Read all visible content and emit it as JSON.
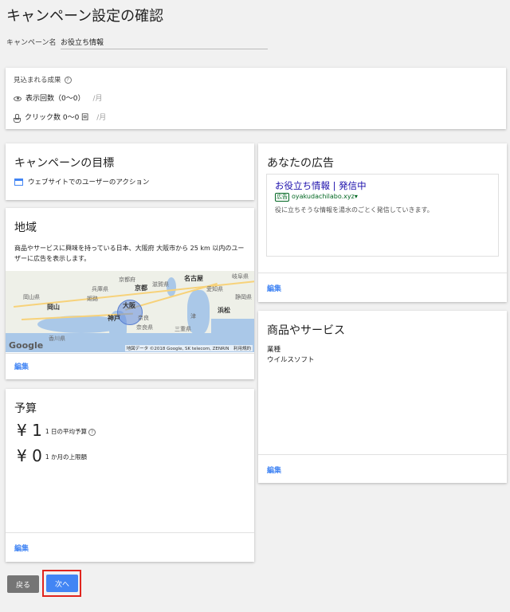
{
  "page": {
    "title": "キャンペーン設定の確認"
  },
  "campaign_name": {
    "label": "キャンペーン名",
    "value": "お役立ち情報"
  },
  "estimate": {
    "title": "見込まれる成果",
    "help_icon": "?",
    "impressions": {
      "label": "表示回数（0〜0）",
      "unit": "/月"
    },
    "clicks": {
      "label": "クリック数 0〜0 回",
      "unit": "/月"
    }
  },
  "goal": {
    "title": "キャンペーンの目標",
    "value": "ウェブサイトでのユーザーのアクション"
  },
  "region": {
    "title": "地域",
    "description": "商品やサービスに興味を持っている日本、大阪府 大阪市から 25 km 以内のユーザーに広告を表示します。",
    "edit": "編集",
    "map": {
      "logo": "Google",
      "attribution": "地図データ ©2018 Google, SK telecom, ZENRIN　利用規約",
      "labels": {
        "kyoto_city": "京都",
        "kyoto_pref": "京都府",
        "nagoya": "名古屋",
        "aichi": "愛知県",
        "hyogo": "兵庫県",
        "shiga": "滋賀県",
        "gifu": "岐阜県",
        "himeji": "姫路",
        "okayama": "岡山",
        "okayama_pref": "岡山県",
        "osaka": "大阪",
        "kobe": "神戸",
        "nara": "奈良",
        "nara_pref": "奈良県",
        "mie": "三重県",
        "hamamatsu": "浜松",
        "shizuoka": "静岡県",
        "kagawa": "香川県",
        "tsu": "津"
      }
    }
  },
  "budget": {
    "title": "予算",
    "daily": {
      "amount": "¥ 1",
      "label": "1 日の平均予算"
    },
    "monthly": {
      "amount": "¥ 0",
      "label": "1 か月の上限額"
    },
    "help_icon": "?",
    "edit": "編集"
  },
  "ad": {
    "title": "あなたの広告",
    "headline": "お役立ち情報 | 発信中",
    "badge": "広告",
    "url": "oyakudachilabo.xyz▾",
    "description": "役に立ちそうな情報を湯水のごとく発信していきます。",
    "edit": "編集"
  },
  "business": {
    "title": "商品やサービス",
    "label": "業種",
    "value": "ウイルスソフト",
    "edit": "編集"
  },
  "buttons": {
    "back": "戻る",
    "next": "次へ"
  },
  "colors": {
    "accent": "#4285f4",
    "highlight": "#e0241e",
    "ad_headline": "#1a0dab",
    "ad_url": "#006621"
  }
}
